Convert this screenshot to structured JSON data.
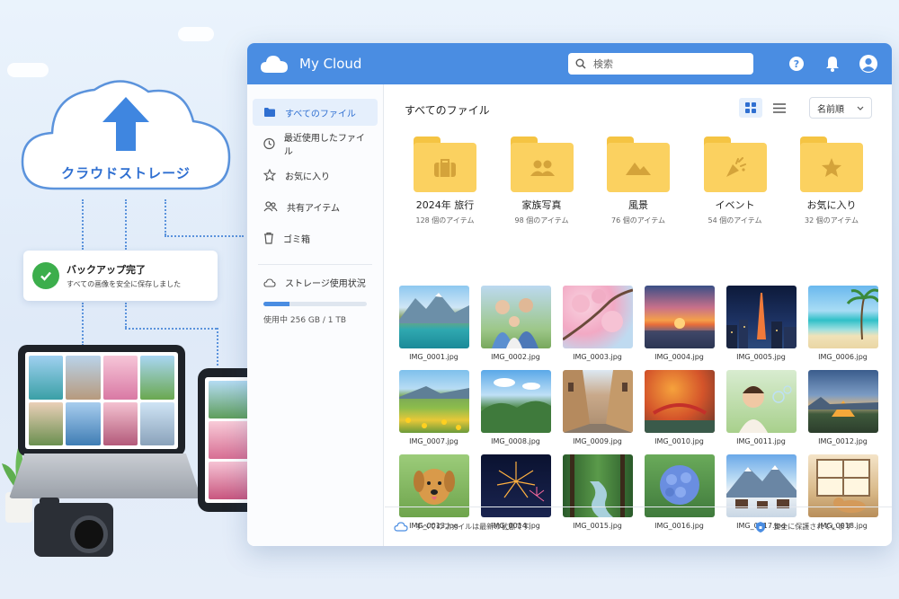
{
  "illustration": {
    "cloud_label": "クラウドストレージ",
    "backup_title": "バックアップ完了",
    "backup_subtitle": "すべての画像を安全に保存しました"
  },
  "app": {
    "name": "My Cloud",
    "search_placeholder": "検索",
    "accent_color": "#4a8de2"
  },
  "sidebar": {
    "items": [
      {
        "label": "すべてのファイル",
        "icon": "folder-icon",
        "active": true
      },
      {
        "label": "最近使用したファイル",
        "icon": "clock-icon",
        "active": false
      },
      {
        "label": "お気に入り",
        "icon": "star-icon",
        "active": false
      },
      {
        "label": "共有アイテム",
        "icon": "people-icon",
        "active": false
      },
      {
        "label": "ゴミ箱",
        "icon": "trash-icon",
        "active": false
      }
    ],
    "storage": {
      "title": "ストレージ使用状況",
      "usage_text": "使用中 256 GB / 1 TB",
      "used_fraction": 0.25
    }
  },
  "main": {
    "title": "すべてのファイル",
    "sort_label": "名前順",
    "folders": [
      {
        "name": "2024年 旅行",
        "count": "128 個のアイテム",
        "icon": "suitcase-icon"
      },
      {
        "name": "家族写真",
        "count": "98 個のアイテム",
        "icon": "people-icon"
      },
      {
        "name": "風景",
        "count": "76 個のアイテム",
        "icon": "mountain-icon"
      },
      {
        "name": "イベント",
        "count": "54 個のアイテム",
        "icon": "party-popper-icon"
      },
      {
        "name": "お気に入り",
        "count": "32 個のアイテム",
        "icon": "star-icon"
      }
    ],
    "photos": [
      {
        "name": "IMG_0001.jpg"
      },
      {
        "name": "IMG_0002.jpg"
      },
      {
        "name": "IMG_0003.jpg"
      },
      {
        "name": "IMG_0004.jpg"
      },
      {
        "name": "IMG_0005.jpg"
      },
      {
        "name": "IMG_0006.jpg"
      },
      {
        "name": "IMG_0007.jpg"
      },
      {
        "name": "IMG_0008.jpg"
      },
      {
        "name": "IMG_0009.jpg"
      },
      {
        "name": "IMG_0010.jpg"
      },
      {
        "name": "IMG_0011.jpg"
      },
      {
        "name": "IMG_0012.jpg"
      },
      {
        "name": "IMG_0013.jpg"
      },
      {
        "name": "IMG_0014.jpg"
      },
      {
        "name": "IMG_0015.jpg"
      },
      {
        "name": "IMG_0016.jpg"
      },
      {
        "name": "IMG_0017.jpg"
      },
      {
        "name": "IMG_0018.jpg"
      }
    ]
  },
  "footer": {
    "sync_status": "すべてのファイルは最新の状態です",
    "security_status": "安全に保護されています"
  }
}
